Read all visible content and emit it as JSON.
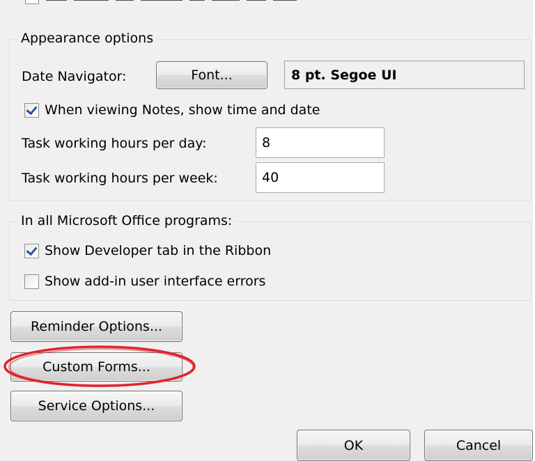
{
  "appearance": {
    "legend": "Appearance options",
    "date_navigator_label": "Date Navigator:",
    "font_button": "Font...",
    "font_value": "8 pt. Segoe UI",
    "notes_checkbox_label": "When viewing Notes, show time and date",
    "notes_checked": true,
    "hours_day_label": "Task working hours per day:",
    "hours_day_value": "8",
    "hours_week_label": "Task working hours per week:",
    "hours_week_value": "40"
  },
  "office": {
    "legend": "In all Microsoft Office programs:",
    "developer_tab_label": "Show Developer tab in the Ribbon",
    "developer_tab_checked": true,
    "addin_errors_label": "Show add-in user interface errors",
    "addin_errors_checked": false
  },
  "buttons": {
    "reminder_options": "Reminder Options...",
    "custom_forms": "Custom Forms...",
    "service_options": "Service Options...",
    "ok": "OK",
    "cancel": "Cancel"
  },
  "colors": {
    "highlight": "#e0242a",
    "checkmark": "#2d4f9e",
    "dialog_bg": "#f0f0f0"
  }
}
